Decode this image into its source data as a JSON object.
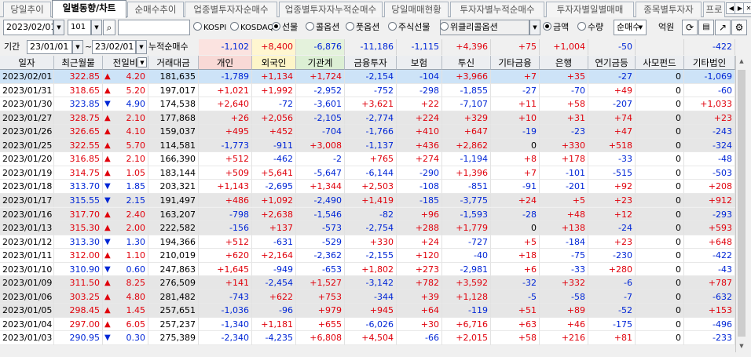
{
  "tabs": [
    "당일추이",
    "일별동향/차트",
    "순매수추이",
    "업종별투자자순매수",
    "업종별투자자누적순매수",
    "당일매매현황",
    "투자자별누적순매수",
    "투자자별일별매매",
    "종목별투자자",
    "프로"
  ],
  "active_tab": 1,
  "toolbar": {
    "date": "2023/02/01",
    "code": "101",
    "search_value": "",
    "markets": [
      {
        "label": "KOSPI",
        "selected": false
      },
      {
        "label": "KOSDAQ",
        "selected": false
      },
      {
        "label": "선물",
        "selected": true
      },
      {
        "label": "콜옵션",
        "selected": false
      },
      {
        "label": "풋옵션",
        "selected": false
      },
      {
        "label": "주식선물",
        "selected": false
      },
      {
        "label": "위클리콜옵션",
        "selected": false
      }
    ],
    "amount_label": "금액",
    "amount_selected": true,
    "qty_label": "수량",
    "qty_selected": false,
    "mode": "순매수",
    "unit": "억원"
  },
  "period": {
    "label": "기간",
    "from": "23/01/01",
    "sep": "~",
    "to": "23/02/01",
    "cum_label": "누적순매수",
    "values": [
      "-1,102",
      "+8,400",
      "-6,876",
      "-11,186",
      "-1,115",
      "+4,396",
      "+75",
      "+1,004",
      "-50",
      "",
      "-422"
    ]
  },
  "columns": [
    "일자",
    "최근월물",
    "전일비",
    "거래대금",
    "개인",
    "외국인",
    "기관계",
    "금융투자",
    "보험",
    "투신",
    "기타금융",
    "은행",
    "연기금등",
    "사모펀드",
    "기타법인"
  ],
  "rows": [
    [
      "2023/02/01",
      "322.85",
      "4.20",
      "181,635",
      "-1,789",
      "+1,134",
      "+1,724",
      "-2,154",
      "-104",
      "+3,966",
      "+7",
      "+35",
      "-27",
      "0",
      "-1,069"
    ],
    [
      "2023/01/31",
      "318.65",
      "5.20",
      "197,017",
      "+1,021",
      "+1,992",
      "-2,952",
      "-752",
      "-298",
      "-1,855",
      "-27",
      "-70",
      "+49",
      "0",
      "-60"
    ],
    [
      "2023/01/30",
      "323.85",
      "4.90",
      "174,538",
      "+2,640",
      "-72",
      "-3,601",
      "+3,621",
      "+22",
      "-7,107",
      "+11",
      "+58",
      "-207",
      "0",
      "+1,033"
    ],
    [
      "2023/01/27",
      "328.75",
      "2.10",
      "177,868",
      "+26",
      "+2,056",
      "-2,105",
      "-2,774",
      "+224",
      "+329",
      "+10",
      "+31",
      "+74",
      "0",
      "+23"
    ],
    [
      "2023/01/26",
      "326.65",
      "4.10",
      "159,037",
      "+495",
      "+452",
      "-704",
      "-1,766",
      "+410",
      "+647",
      "-19",
      "-23",
      "+47",
      "0",
      "-243"
    ],
    [
      "2023/01/25",
      "322.55",
      "5.70",
      "114,581",
      "-1,773",
      "-911",
      "+3,008",
      "-1,137",
      "+436",
      "+2,862",
      "0",
      "+330",
      "+518",
      "0",
      "-324"
    ],
    [
      "2023/01/20",
      "316.85",
      "2.10",
      "166,390",
      "+512",
      "-462",
      "-2",
      "+765",
      "+274",
      "-1,194",
      "+8",
      "+178",
      "-33",
      "0",
      "-48"
    ],
    [
      "2023/01/19",
      "314.75",
      "1.05",
      "183,144",
      "+509",
      "+5,641",
      "-5,647",
      "-6,144",
      "-290",
      "+1,396",
      "+7",
      "-101",
      "-515",
      "0",
      "-503"
    ],
    [
      "2023/01/18",
      "313.70",
      "1.85",
      "203,321",
      "+1,143",
      "-2,695",
      "+1,344",
      "+2,503",
      "-108",
      "-851",
      "-91",
      "-201",
      "+92",
      "0",
      "+208"
    ],
    [
      "2023/01/17",
      "315.55",
      "2.15",
      "191,497",
      "+486",
      "+1,092",
      "-2,490",
      "+1,419",
      "-185",
      "-3,775",
      "+24",
      "+5",
      "+23",
      "0",
      "+912"
    ],
    [
      "2023/01/16",
      "317.70",
      "2.40",
      "163,207",
      "-798",
      "+2,638",
      "-1,546",
      "-82",
      "+96",
      "-1,593",
      "-28",
      "+48",
      "+12",
      "0",
      "-293"
    ],
    [
      "2023/01/13",
      "315.30",
      "2.00",
      "222,582",
      "-156",
      "+137",
      "-573",
      "-2,754",
      "+288",
      "+1,779",
      "0",
      "+138",
      "-24",
      "0",
      "+593"
    ],
    [
      "2023/01/12",
      "313.30",
      "1.30",
      "194,366",
      "+512",
      "-631",
      "-529",
      "+330",
      "+24",
      "-727",
      "+5",
      "-184",
      "+23",
      "0",
      "+648"
    ],
    [
      "2023/01/11",
      "312.00",
      "1.10",
      "210,019",
      "+620",
      "+2,164",
      "-2,362",
      "-2,155",
      "+120",
      "-40",
      "+18",
      "-75",
      "-230",
      "0",
      "-422"
    ],
    [
      "2023/01/10",
      "310.90",
      "0.60",
      "247,863",
      "+1,645",
      "-949",
      "-653",
      "+1,802",
      "+273",
      "-2,981",
      "+6",
      "-33",
      "+280",
      "0",
      "-43"
    ],
    [
      "2023/01/09",
      "311.50",
      "8.25",
      "276,509",
      "+141",
      "-2,454",
      "+1,527",
      "-3,142",
      "+782",
      "+3,592",
      "-32",
      "+332",
      "-6",
      "0",
      "+787"
    ],
    [
      "2023/01/06",
      "303.25",
      "4.80",
      "281,482",
      "-743",
      "+622",
      "+753",
      "-344",
      "+39",
      "+1,128",
      "-5",
      "-58",
      "-7",
      "0",
      "-632"
    ],
    [
      "2023/01/05",
      "298.45",
      "1.45",
      "257,651",
      "-1,036",
      "-96",
      "+979",
      "+945",
      "+64",
      "-119",
      "+51",
      "+89",
      "-52",
      "0",
      "+153"
    ],
    [
      "2023/01/04",
      "297.00",
      "6.05",
      "257,237",
      "-1,340",
      "+1,181",
      "+655",
      "-6,026",
      "+30",
      "+6,716",
      "+63",
      "+46",
      "-175",
      "0",
      "-496"
    ],
    [
      "2023/01/03",
      "290.95",
      "0.30",
      "275,389",
      "-2,340",
      "-4,235",
      "+6,808",
      "+4,504",
      "-66",
      "+2,015",
      "+58",
      "+216",
      "+81",
      "0",
      "-233"
    ]
  ],
  "change_dirs": [
    "up",
    "up",
    "down",
    "up",
    "up",
    "up",
    "up",
    "up",
    "down",
    "down",
    "up",
    "up",
    "down",
    "up",
    "down",
    "up",
    "up",
    "up",
    "up",
    "down"
  ],
  "colors": {
    "up": "#e0000b",
    "down": "#0026d6",
    "selected_row": "#cde3f7",
    "band": "#e6e6e6",
    "header_individual": "#f8d9d6",
    "header_foreign": "#fdf5c8",
    "header_inst": "#dcefd4"
  }
}
